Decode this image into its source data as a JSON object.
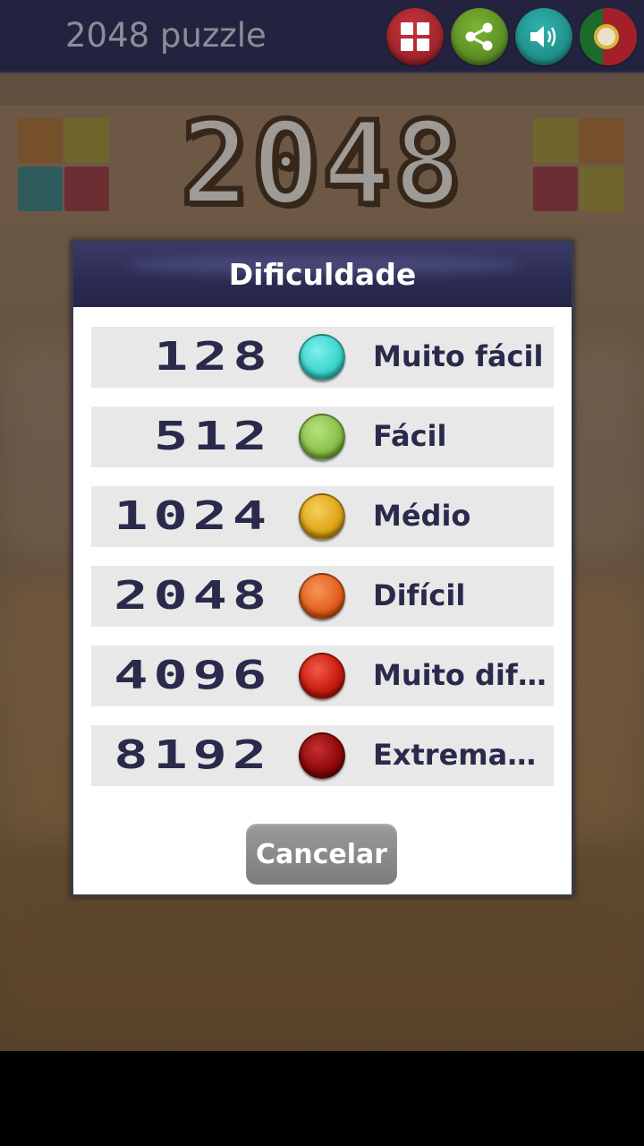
{
  "appbar": {
    "title": "2048 puzzle",
    "buttons": [
      {
        "name": "grid-menu-icon",
        "color": "#b52a33"
      },
      {
        "name": "share-icon",
        "color": "#6aa12a"
      },
      {
        "name": "sound-icon",
        "color": "#25a09a"
      },
      {
        "name": "portugal-flag-icon",
        "color": "#a3202b"
      }
    ]
  },
  "background": {
    "logo_text": "2048",
    "tile_colors": [
      "#8a5a2a",
      "#7e7a2c",
      "#246a72",
      "#7a2a36"
    ]
  },
  "dialog": {
    "title": "Dificuldade",
    "options": [
      {
        "number": "128",
        "label": "Muito fácil",
        "color": "#3fd6d0"
      },
      {
        "number": "512",
        "label": "Fácil",
        "color": "#8bc34a"
      },
      {
        "number": "1024",
        "label": "Médio",
        "color": "#e0a81a"
      },
      {
        "number": "2048",
        "label": "Difícil",
        "color": "#e5621e"
      },
      {
        "number": "4096",
        "label": "Muito difícil",
        "color": "#cc1e12"
      },
      {
        "number": "8192",
        "label": "Extremam...",
        "color": "#930a0a"
      }
    ],
    "cancel_label": "Cancelar"
  }
}
